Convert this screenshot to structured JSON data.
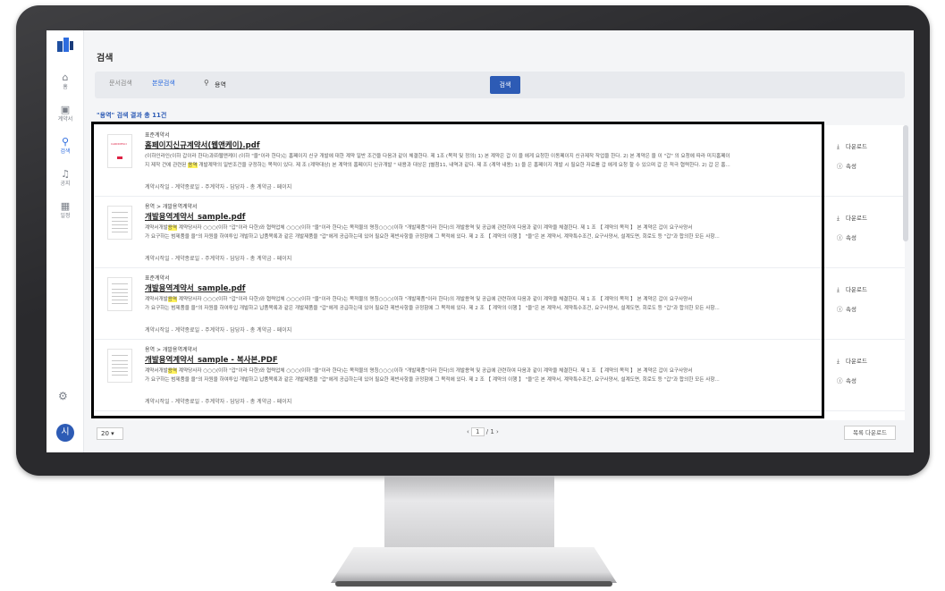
{
  "nav": {
    "items": [
      {
        "label": "홈",
        "icon": "home-icon"
      },
      {
        "label": "계약서",
        "icon": "document-icon"
      },
      {
        "label": "검색",
        "icon": "search-icon"
      },
      {
        "label": "공지",
        "icon": "bell-icon"
      },
      {
        "label": "일정",
        "icon": "calendar-icon"
      }
    ],
    "avatar": "시"
  },
  "page": {
    "title": "검색"
  },
  "search": {
    "tab_doc": "문서검색",
    "tab_body": "본문검색",
    "query": "용역",
    "button": "검색",
    "result_info": "\"용역\" 검색 결과 총 11건"
  },
  "results": [
    {
      "category": "표준계약서",
      "filename": "홈페이지신규계약서(웹앤케이).pdf",
      "snippet1": "(이하인라인(이하 갑이라 한다)과㈜웹앤케이 (이하 \"을\"이라 한다)는 홈페이지 신규 개발에 대한 계약 일반 조건을 다음과 같이 체결한다. 제 1조 (목적 및 정의) 1) 본 계약은 갑 이 을 에게 요청한 이동페이지 신규제작 작업을 한다. 2) 본 계약은 을 이 \"갑\" 의 요청에 따라 미지홈페이",
      "snippet2_pre": "지 제작 건에 관련된 ",
      "snippet2_hl": "용역",
      "snippet2_post": " 개발계약의 일반조건을 규정하는 목적이 있다. 제 조 (계약대상) 본 계약의 홈페이지 신규개발 \" 내용과 대상은 ]별첨11, 내역과 같다. 제 조 (계약 내용) 1) 을 은 홈페이지 개발 시 필요한 자료를 갑 에게 요청 할 수 있으며 갑 은 적극 협력한다. 2) 갑 은 홈...",
      "meta": "계약시작일 -   계약종료일 -   주계약자 -   담당자 -   총 계약금 -   페이지"
    },
    {
      "category": "용역 > 개발용역계약서",
      "filename": "개발용역계약서_sample.pdf",
      "snippet1_pre": "계약서개발",
      "snippet1_hl": "용역",
      "snippet1_post": " 계약당사자 ○○○(이하 \"갑\"이라 다한)와 협력업체 ○○○(이하 \"을\"이라 한다)는 목적물의 명칭○○○(이하 \"개발제품\"이라 한다)의 개발용역 및 공급에 관련하여 다음과 같이 계약을 체결한다. 제 1 조 【 계약의 목적 】 본 계약은 갑이 요구사양서",
      "snippet2": "가 요구하는 범제품을 을\"의 자원을 하여투입 개발하고 납품목록과 같은 개발제품을 \"갑\"에게 공급하는데 있어 필요한 제반사항을 규정함에 그 목적에 있다. 제 2 조 【 계약의 이행 】 \"을\"은 본 계약서, 계약특수조건, 요구사양서, 설계도면, 회로도 등 \"갑\"과 합의한 모든 사항...",
      "meta": "계약시작일 -   계약종료일 -   주계약자 -   담당자 -   총 계약금 -   페이지"
    },
    {
      "category": "표준계약서",
      "filename": "개발용역계약서_sample.pdf",
      "snippet1_pre": "계약서개발",
      "snippet1_hl": "용역",
      "snippet1_post": " 계약당사자 ○○○(이하 \"갑\"이라 다한)와 협력업체 ○○○(이하 \"을\"이라 한다)는 목적물의 명칭○○○(이하 \"개발제품\"이라 한다)의 개발용역 및 공급에 관련하여 다음과 같이 계약을 체결한다. 제 1 조 【 계약의 목적 】 본 계약은 갑이 요구사양서",
      "snippet2": "가 요구하는 범제품을 을\"의 자원을 하여투입 개발하고 납품목록과 같은 개발제품을 \"갑\"에게 공급하는데 있어 필요한 제반사항을 규정함에 그 목적에 있다. 제 2 조 【 계약의 이행 】 \"을\"은 본 계약서, 계약특수조건, 요구사양서, 설계도면, 회로도 등 \"갑\"과 합의한 모든 사항...",
      "meta": "계약시작일 -   계약종료일 -   주계약자 -   담당자 -   총 계약금 -   페이지"
    },
    {
      "category": "용역 > 개발용역계약서",
      "filename": "개발용역계약서_sample - 복사본.PDF",
      "snippet1_pre": "계약서개발",
      "snippet1_hl": "용역",
      "snippet1_post": " 계약당사자 ○○○(이하 \"갑\"이라 다한)와 협력업체 ○○○(이하 \"을\"이라 한다)는 목적물의 명칭○○○(이하 \"개발제품\"이라 한다)의 개발용역 및 공급에 관련하여 다음과 같이 계약을 체결한다. 제 1 조 【 계약의 목적 】 본 계약은 갑이 요구사양서",
      "snippet2": "가 요구하는 범제품을 을\"의 자원을 하여투입 개발하고 납품목록과 같은 개발제품을 \"갑\"에게 공급하는데 있어 필요한 제반사항을 규정함에 그 목적에 있다. 제 2 조 【 계약의 이행 】 \"을\"은 본 계약서, 계약특수조건, 요구사양서, 설계도면, 회로도 등 \"갑\"과 합의한 모든 사항...",
      "meta": "계약시작일 -   계약종료일 -   주계약자 -   담당자 -   총 계약금 -   페이지"
    }
  ],
  "actions": {
    "download": "다운로드",
    "properties": "속성"
  },
  "footer": {
    "page_size": "20",
    "page_current": "1",
    "page_total": "/ 1",
    "download_list": "목록 다운로드"
  }
}
